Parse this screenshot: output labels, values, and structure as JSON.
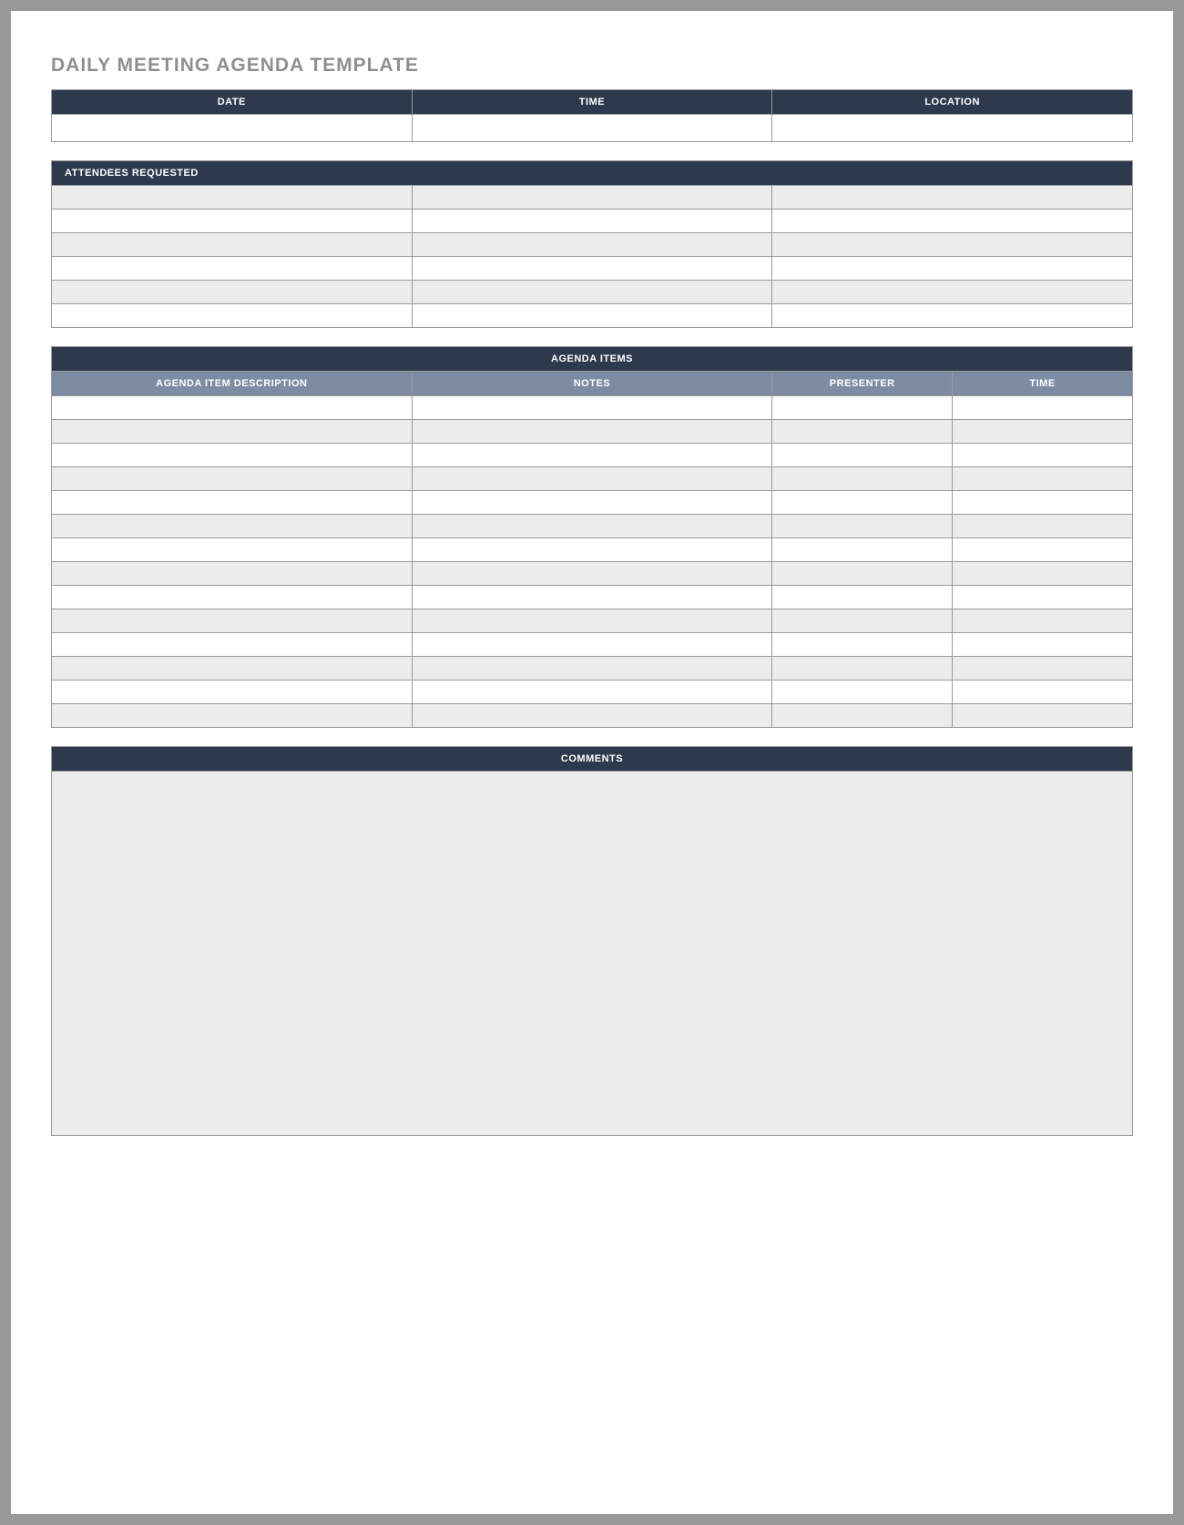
{
  "title": "DAILY MEETING AGENDA TEMPLATE",
  "dtl": {
    "headers": [
      "DATE",
      "TIME",
      "LOCATION"
    ],
    "values": [
      "",
      "",
      ""
    ]
  },
  "attendees": {
    "header": "ATTENDEES REQUESTED",
    "rows": [
      [
        "",
        "",
        ""
      ],
      [
        "",
        "",
        ""
      ],
      [
        "",
        "",
        ""
      ],
      [
        "",
        "",
        ""
      ],
      [
        "",
        "",
        ""
      ],
      [
        "",
        "",
        ""
      ]
    ]
  },
  "agenda": {
    "header": "AGENDA ITEMS",
    "columns": [
      "AGENDA ITEM DESCRIPTION",
      "NOTES",
      "PRESENTER",
      "TIME"
    ],
    "rows": [
      [
        "",
        "",
        "",
        ""
      ],
      [
        "",
        "",
        "",
        ""
      ],
      [
        "",
        "",
        "",
        ""
      ],
      [
        "",
        "",
        "",
        ""
      ],
      [
        "",
        "",
        "",
        ""
      ],
      [
        "",
        "",
        "",
        ""
      ],
      [
        "",
        "",
        "",
        ""
      ],
      [
        "",
        "",
        "",
        ""
      ],
      [
        "",
        "",
        "",
        ""
      ],
      [
        "",
        "",
        "",
        ""
      ],
      [
        "",
        "",
        "",
        ""
      ],
      [
        "",
        "",
        "",
        ""
      ],
      [
        "",
        "",
        "",
        ""
      ],
      [
        "",
        "",
        "",
        ""
      ]
    ]
  },
  "comments": {
    "header": "COMMENTS",
    "value": ""
  }
}
